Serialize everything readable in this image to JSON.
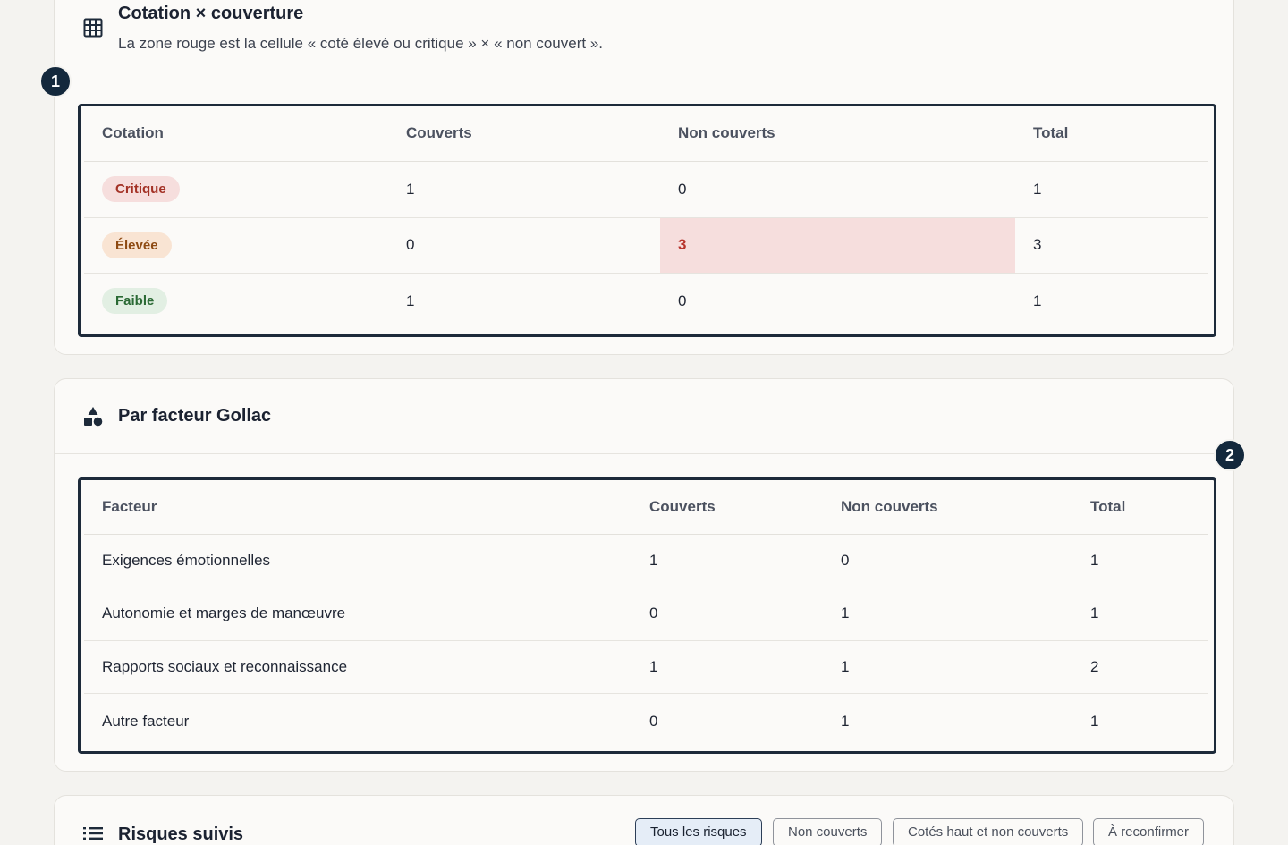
{
  "cotation_section": {
    "title": "Cotation × couverture",
    "subtitle": "La zone rouge est la cellule « coté élevé ou critique » × « non couvert ».",
    "marker": "1",
    "columns": [
      "Cotation",
      "Couverts",
      "Non couverts",
      "Total"
    ],
    "rows": [
      {
        "label": "Critique",
        "covered": "1",
        "not_covered": "0",
        "total": "1"
      },
      {
        "label": "Élevée",
        "covered": "0",
        "not_covered": "3",
        "total": "3"
      },
      {
        "label": "Faible",
        "covered": "1",
        "not_covered": "0",
        "total": "1"
      }
    ],
    "badge_colors": {
      "critique": {
        "bg": "#f6dedd",
        "fg": "#a33226"
      },
      "elevee": {
        "bg": "#f9e4d3",
        "fg": "#8e4a12"
      },
      "faible": {
        "bg": "#e2efe3",
        "fg": "#2b6a35"
      }
    },
    "highlight_color": "#f6dedd"
  },
  "gollac_section": {
    "title": "Par facteur Gollac",
    "marker": "2",
    "columns": [
      "Facteur",
      "Couverts",
      "Non couverts",
      "Total"
    ],
    "rows": [
      {
        "label": "Exigences émotionnelles",
        "covered": "1",
        "not_covered": "0",
        "total": "1"
      },
      {
        "label": "Autonomie et marges de manœuvre",
        "covered": "0",
        "not_covered": "1",
        "total": "1"
      },
      {
        "label": "Rapports sociaux et reconnaissance",
        "covered": "1",
        "not_covered": "1",
        "total": "2"
      },
      {
        "label": "Autre facteur",
        "covered": "0",
        "not_covered": "1",
        "total": "1"
      }
    ]
  },
  "risks_section": {
    "title": "Risques suivis",
    "filters": [
      {
        "label": "Tous les risques",
        "active": true
      },
      {
        "label": "Non couverts",
        "active": false
      },
      {
        "label": "Cotés haut et non couverts",
        "active": false
      },
      {
        "label": "À reconfirmer",
        "active": false
      }
    ]
  },
  "icons": {
    "cotation": "grid-table-icon",
    "gollac": "shapes-icon",
    "risks": "list-icon"
  }
}
